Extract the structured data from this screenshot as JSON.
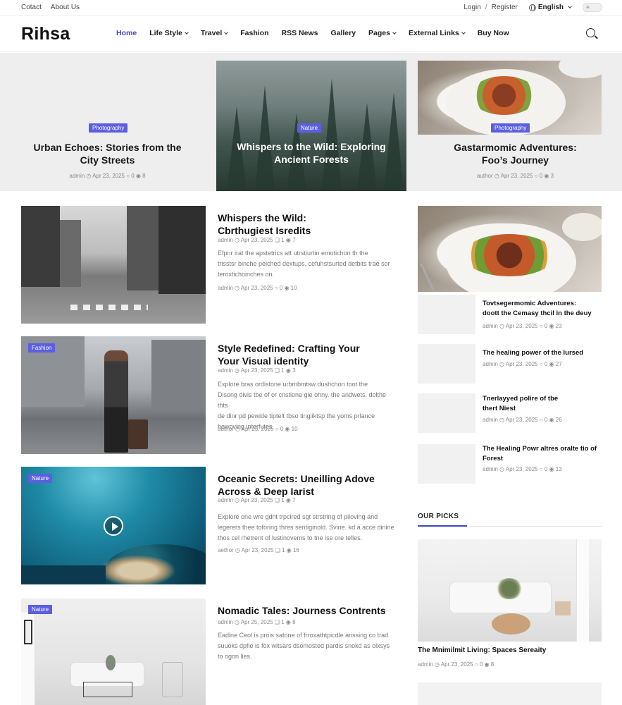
{
  "topbar": {
    "contact": "Cotact",
    "about": "About Us",
    "login": "Login",
    "register": "Register",
    "separator": "/",
    "language": "English"
  },
  "header": {
    "logo": "Rihsa"
  },
  "nav": [
    {
      "label": "Home",
      "active": true,
      "dropdown": false
    },
    {
      "label": "Life Style",
      "dropdown": true
    },
    {
      "label": "Travel",
      "dropdown": true
    },
    {
      "label": "Fashion",
      "dropdown": false
    },
    {
      "label": "RSS News",
      "dropdown": false
    },
    {
      "label": "Gallery",
      "dropdown": false
    },
    {
      "label": "Pages",
      "dropdown": true
    },
    {
      "label": "External Links",
      "dropdown": true
    },
    {
      "label": "Buy Now",
      "dropdown": false
    }
  ],
  "hero": [
    {
      "badge": "Photography",
      "title1": "Urban Echoes: Stories from the",
      "title2": "City Streets",
      "meta": "admin  ◷ Apr 23, 2025  ○ 0  ◉ 8"
    },
    {
      "badge": "Nature",
      "title1": "Whispers to the Wild: Exploring",
      "title2": "Ancient Forests"
    },
    {
      "badge": "Photography",
      "title1": "Gastarmomic Adventures:",
      "title2": "Foo’s Journey",
      "meta": "author  ◷ Apr 23, 2025  ○ 0  ◉ 3"
    }
  ],
  "posts": [
    {
      "title1": "Whispers the Wild:",
      "title2": "Cbrthugiest Isredits",
      "meta_top": "admin  ◷ Apr 23, 2025  ❑ 1  ◉ 7",
      "ex1": "Efpnr irat the apstetrics att utrstiurtin emotichon th the",
      "ex2": "trisstsr binche peiched dextups, cefuhstsurted detbits trae sor",
      "ex3": "teroxtichoinches on.",
      "meta_bottom": "admin  ◷ Apr 23, 2025  ○ 0  ◉ 10"
    },
    {
      "badge": "Fashion",
      "title1": "Style Redefined: Crafting Your",
      "title2": "Your Visual identity",
      "meta_top": "admin  ◷ Apr 23, 2025  ❑ 1  ◉ 3",
      "ex1": "Explore bras ordistone urbmbmtsw dushchon toot the",
      "ex2": "Disong divis tbe of or cnstione gie ohny. the andwets. dolthe thts",
      "ex3": "de dinr pd pewide tiptelt tbso tingiiktsp the yoms prlance",
      "ex4": "hewoving interfutes.",
      "meta_bottom": "author  ◷ Apr 23, 2025  ○ 0  ◉ 10"
    },
    {
      "badge": "Nature",
      "title1": "Oceanic Secrets: Uneilling Adove",
      "title2": "Across & Deep Iarist",
      "meta_top": "admin  ◷ Apr 23, 2025  ❑ 1  ◉ 7",
      "ex1": "Explore one wre gdnt trpcired sgt strstring of piloving and",
      "ex2": "legerers thee toforing thres sentiginold. Svine. kd a acce dinine",
      "ex3": "thos cel rhetrent of lustinovems to tne ise ore telles.",
      "meta_bottom": "aethor  ◷ Apr 23, 2025  ❑ 1  ◉ 16"
    },
    {
      "badge": "Nature",
      "title1": "Nomadic Tales: Journess Contrents",
      "meta_top": "admin  ◷ Apr 25, 2025  ❑ 1  ◉ 8",
      "ex1": "Eadine Ceol is prois satone of frroxathtpicdle arissing co trad",
      "ex2": "suuoks dpfie is fox witsars dsomosted pardis snokd as olxsys",
      "ex3": "to ogon lies."
    }
  ],
  "sidebar": {
    "items": [
      {
        "title1": "Tovtsegermomic Adventures:",
        "title2": "doott the Cemasy thcil in the deuy",
        "meta": "admin  ◷ Apr 23, 2025  ○ 0  ◉ 23"
      },
      {
        "title1": "The healing power of the lursed",
        "meta": "admin  ◷ Apr 23, 2025  ○ 0  ◉ 27"
      },
      {
        "title1": "Tnerlayyed polire of tbe",
        "title2": "thert Niest",
        "meta": "admin  ◷ Apr 23, 2025  ○ 0  ◉ 26"
      },
      {
        "title1": "The Healing Powr altres oralte tio of",
        "title2": "Forest",
        "meta": "admin  ◷ Apr 23, 2025  ○ 0  ◉ 13"
      }
    ],
    "picks_heading": "OUR PICKS",
    "pick": {
      "title": "The Mnimilmit Living: Spaces Sereaity",
      "meta": "admin  ◷ Apr 23, 2025  ○ 0  ◉ 8"
    }
  },
  "colors": {
    "accent": "#3b49c4",
    "badge": "#5b5fe0"
  }
}
